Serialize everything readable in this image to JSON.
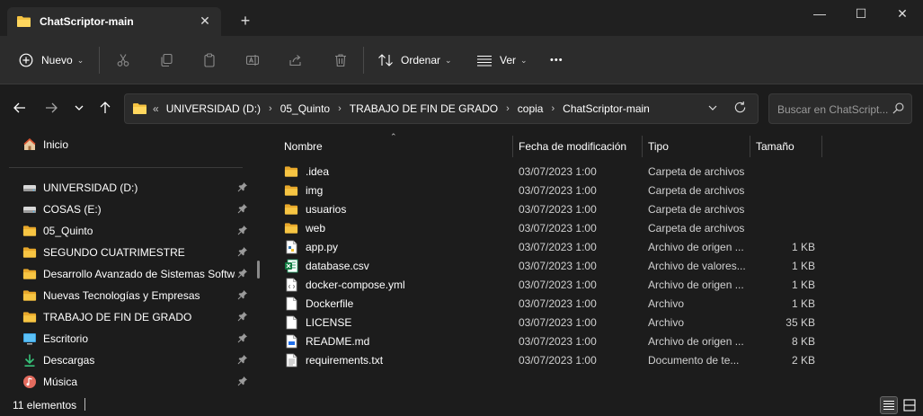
{
  "window": {
    "tab_title": "ChatScriptor-main",
    "tab_close": "✕",
    "new_tab": "+",
    "minimize": "—",
    "maximize": "☐",
    "close": "✕"
  },
  "toolbar": {
    "new_label": "Nuevo",
    "sort_label": "Ordenar",
    "view_label": "Ver",
    "more_label": "•••",
    "icons": [
      "plus-circle-icon",
      "cut-icon",
      "copy-icon",
      "paste-icon",
      "rename-icon",
      "share-icon",
      "delete-icon",
      "sort-icon",
      "view-icon",
      "more-icon"
    ]
  },
  "address": {
    "overflow": "«",
    "crumbs": [
      "UNIVERSIDAD (D:)",
      "05_Quinto",
      "TRABAJO DE FIN DE GRADO",
      "copia",
      "ChatScriptor-main"
    ],
    "separator": "›"
  },
  "search": {
    "placeholder": "Buscar en ChatScript..."
  },
  "sidebar": {
    "home": {
      "label": "Inicio",
      "icon": "home-icon"
    },
    "items": [
      {
        "label": "UNIVERSIDAD (D:)",
        "icon": "drive-icon",
        "pinned": true
      },
      {
        "label": "COSAS (E:)",
        "icon": "drive-icon",
        "pinned": true
      },
      {
        "label": "05_Quinto",
        "icon": "folder-icon",
        "pinned": true
      },
      {
        "label": "SEGUNDO CUATRIMESTRE",
        "icon": "folder-icon",
        "pinned": true
      },
      {
        "label": "Desarrollo Avanzado de Sistemas Software",
        "icon": "folder-icon",
        "pinned": true
      },
      {
        "label": "Nuevas Tecnologías y Empresas",
        "icon": "folder-icon",
        "pinned": true
      },
      {
        "label": "TRABAJO DE FIN DE GRADO",
        "icon": "folder-icon",
        "pinned": true
      },
      {
        "label": "Escritorio",
        "icon": "desktop-icon",
        "pinned": true
      },
      {
        "label": "Descargas",
        "icon": "download-icon",
        "pinned": true
      },
      {
        "label": "Música",
        "icon": "music-icon",
        "pinned": true
      }
    ]
  },
  "columns": {
    "name": "Nombre",
    "date": "Fecha de modificación",
    "type": "Tipo",
    "size": "Tamaño"
  },
  "files": [
    {
      "name": ".idea",
      "date": "03/07/2023 1:00",
      "type": "Carpeta de archivos",
      "size": "",
      "icon": "folder-icon"
    },
    {
      "name": "img",
      "date": "03/07/2023 1:00",
      "type": "Carpeta de archivos",
      "size": "",
      "icon": "folder-icon"
    },
    {
      "name": "usuarios",
      "date": "03/07/2023 1:00",
      "type": "Carpeta de archivos",
      "size": "",
      "icon": "folder-icon"
    },
    {
      "name": "web",
      "date": "03/07/2023 1:00",
      "type": "Carpeta de archivos",
      "size": "",
      "icon": "folder-icon"
    },
    {
      "name": "app.py",
      "date": "03/07/2023 1:00",
      "type": "Archivo de origen ...",
      "size": "1 KB",
      "icon": "python-file-icon"
    },
    {
      "name": "database.csv",
      "date": "03/07/2023 1:00",
      "type": "Archivo de valores...",
      "size": "1 KB",
      "icon": "excel-file-icon"
    },
    {
      "name": "docker-compose.yml",
      "date": "03/07/2023 1:00",
      "type": "Archivo de origen ...",
      "size": "1 KB",
      "icon": "code-file-icon"
    },
    {
      "name": "Dockerfile",
      "date": "03/07/2023 1:00",
      "type": "Archivo",
      "size": "1 KB",
      "icon": "file-icon"
    },
    {
      "name": "LICENSE",
      "date": "03/07/2023 1:00",
      "type": "Archivo",
      "size": "35 KB",
      "icon": "file-icon"
    },
    {
      "name": "README.md",
      "date": "03/07/2023 1:00",
      "type": "Archivo de origen ...",
      "size": "8 KB",
      "icon": "markdown-file-icon"
    },
    {
      "name": "requirements.txt",
      "date": "03/07/2023 1:00",
      "type": "Documento de te...",
      "size": "2 KB",
      "icon": "text-file-icon"
    }
  ],
  "status": {
    "count": "11 elementos"
  },
  "colors": {
    "background": "#1c1c1c",
    "toolbar": "#2c2c2c",
    "folder": "#f5c342",
    "accent": "#4cc2ff"
  }
}
